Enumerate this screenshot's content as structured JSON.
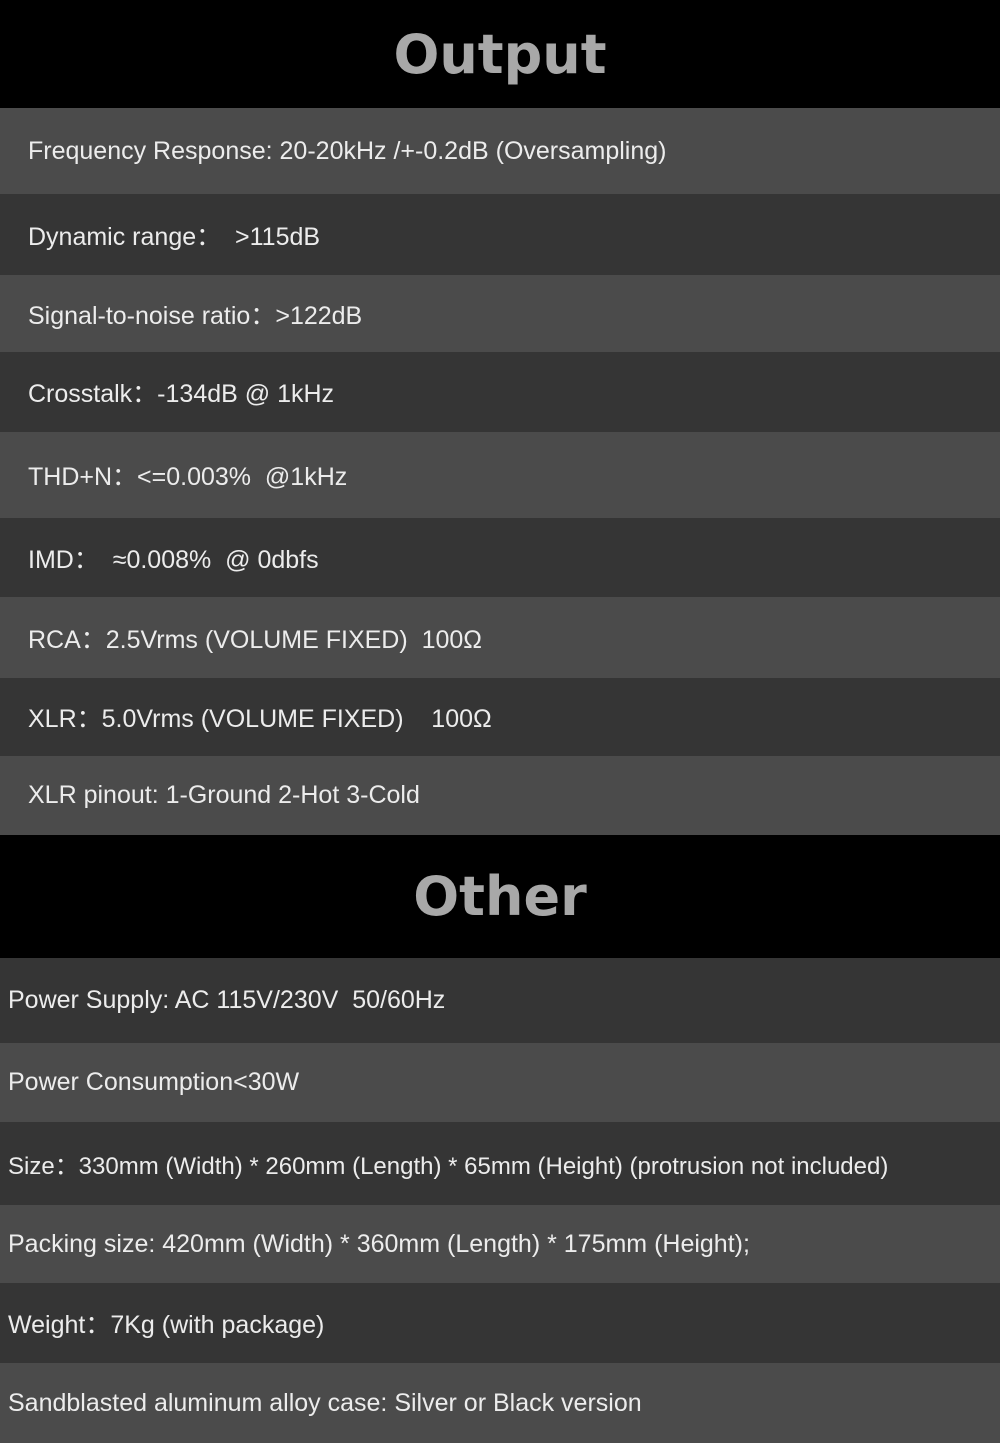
{
  "output": {
    "title": "Output",
    "rows": [
      "Frequency Response: 20-20kHz /+-0.2dB (Oversampling)",
      "Dynamic range：  >115dB",
      "Signal-to-noise ratio：>122dB",
      "Crosstalk：-134dB @ 1kHz",
      "THD+N：<=0.003%  @1kHz",
      "IMD：  ≈0.008%  @ 0dbfs",
      "RCA：2.5Vrms (VOLUME FIXED)  100Ω",
      "XLR：5.0Vrms (VOLUME FIXED)    100Ω",
      "XLR pinout: 1-Ground 2-Hot 3-Cold"
    ]
  },
  "other": {
    "title": "Other",
    "rows": [
      "Power Supply: AC 115V/230V  50/60Hz",
      "Power Consumption<30W",
      "Size：330mm (Width) * 260mm (Length) * 65mm (Height) (protrusion not included)",
      "Packing size: 420mm (Width) * 360mm (Length) * 175mm (Height);",
      "Weight：7Kg (with package)",
      "Sandblasted aluminum alloy case: Silver or Black version"
    ]
  }
}
